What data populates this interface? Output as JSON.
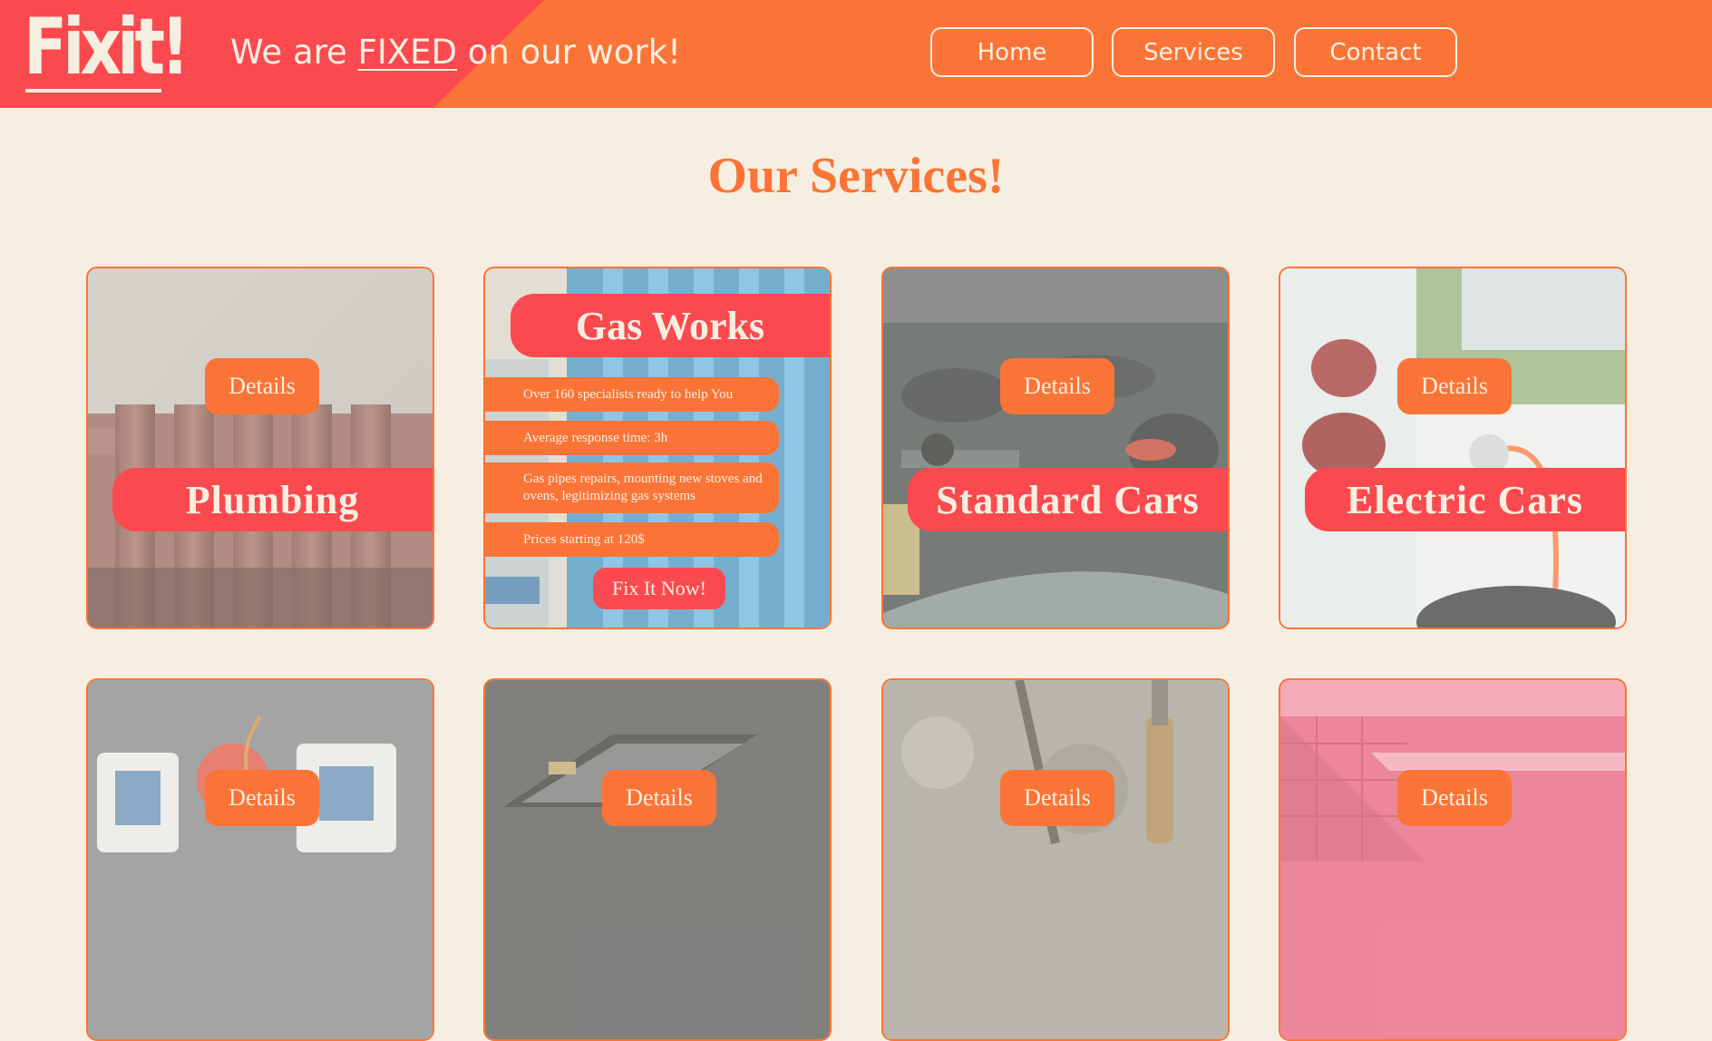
{
  "header": {
    "logo": "Fixit!",
    "tagline_pre": "We are ",
    "tagline_emph": "FIXED",
    "tagline_post": " on our work!",
    "nav": [
      {
        "label": "Home"
      },
      {
        "label": "Services"
      },
      {
        "label": "Contact"
      }
    ]
  },
  "main": {
    "title": "Our Services!",
    "cards": [
      {
        "name": "Plumbing",
        "details": "Details"
      },
      {
        "name": "Gas Works",
        "facts": [
          "Over 160 specialists ready to help You",
          "Average response time: 3h",
          "Gas pipes repairs, mounting new stoves and ovens, legitimizing gas systems",
          "Prices starting at 120$"
        ],
        "cta": "Fix It Now!"
      },
      {
        "name": "Standard Cars",
        "details": "Details"
      },
      {
        "name": "Electric Cars",
        "details": "Details"
      },
      {
        "details": "Details"
      },
      {
        "details": "Details"
      },
      {
        "details": "Details"
      },
      {
        "details": "Details"
      }
    ]
  },
  "colors": {
    "background": "#f6efe1",
    "orange": "#fb7437",
    "red": "#fb4a4f"
  }
}
